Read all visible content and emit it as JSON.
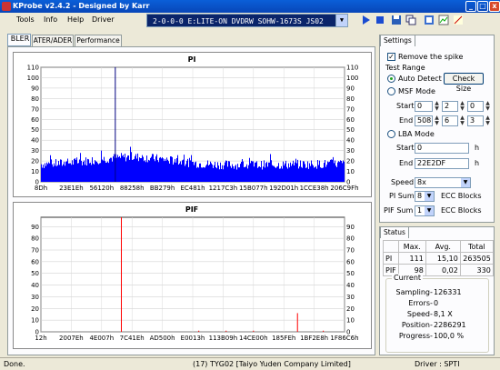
{
  "window": {
    "title": "KProbe v2.4.2 - Designed by Karr",
    "min": "_",
    "max": "□",
    "close": "x"
  },
  "menu": [
    "Tools",
    "Info",
    "Help",
    "Driver"
  ],
  "drive": {
    "value": "2-0-0-0 E:LITE-ON DVDRW SOHW-1673S JS02"
  },
  "tabs": [
    "BLER",
    "ATER/ADER",
    "Performance"
  ],
  "pi_chart": {
    "title": "PI",
    "yticks": [
      "110",
      "100",
      "90",
      "80",
      "70",
      "60",
      "50",
      "40",
      "30",
      "20",
      "10",
      "0"
    ],
    "xticks": [
      "8Dh",
      "23E1Eh",
      "56120h",
      "88258h",
      "BB279h",
      "EC481h",
      "1217C3h",
      "15B077h",
      "192D01h",
      "1CCE38h",
      "206C9Fh"
    ]
  },
  "pif_chart": {
    "title": "PIF",
    "yticks": [
      "90",
      "80",
      "70",
      "60",
      "50",
      "40",
      "30",
      "20",
      "10",
      "0"
    ],
    "xticks": [
      "12h",
      "2007Eh",
      "4E007h",
      "7C41Eh",
      "AD500h",
      "E0013h",
      "113B09h",
      "14CE00h",
      "185FEh",
      "1BF2E8h",
      "1F86C6h"
    ]
  },
  "settings": {
    "tab": "Settings",
    "remove_spike": "Remove the spike",
    "test_range": "Test Range",
    "auto_detect": "Auto Detect",
    "check_size": "Check Size",
    "msf_mode": "MSF Mode",
    "start": "Start",
    "end": "End",
    "msf_start": [
      "0",
      "2",
      "0"
    ],
    "msf_end": [
      "508",
      "6",
      "3"
    ],
    "lba_mode": "LBA Mode",
    "lba_start": "0",
    "lba_end": "22E2DF",
    "h": "h",
    "speed_label": "Speed",
    "speed_value": "8x",
    "pi_sum_label": "PI Sum",
    "pi_sum_value": "8",
    "pif_sum_label": "PIF Sum",
    "pif_sum_value": "1",
    "ecc_blocks": "ECC Blocks"
  },
  "status": {
    "tab": "Status",
    "headers": [
      "",
      "Max.",
      "Avg.",
      "Total"
    ],
    "rows": [
      [
        "PI",
        "111",
        "15,10",
        "263505"
      ],
      [
        "PIF",
        "98",
        "0,02",
        "330"
      ]
    ],
    "current": "Current",
    "fields": [
      {
        "k": "Sampling",
        "v": "126331"
      },
      {
        "k": "Errors",
        "v": "0"
      },
      {
        "k": "Speed",
        "v": "8,1  X"
      },
      {
        "k": "Position",
        "v": "2286291"
      },
      {
        "k": "Progress",
        "v": "100,0 %"
      }
    ]
  },
  "statusbar": {
    "left": "Done.",
    "center": "(17) TYG02 [Taiyo Yuden Company Limited]",
    "right": "Driver : SPTI"
  },
  "colors": {
    "pi": "#0000ff",
    "pif": "#ff0000",
    "spike": "#000080"
  }
}
